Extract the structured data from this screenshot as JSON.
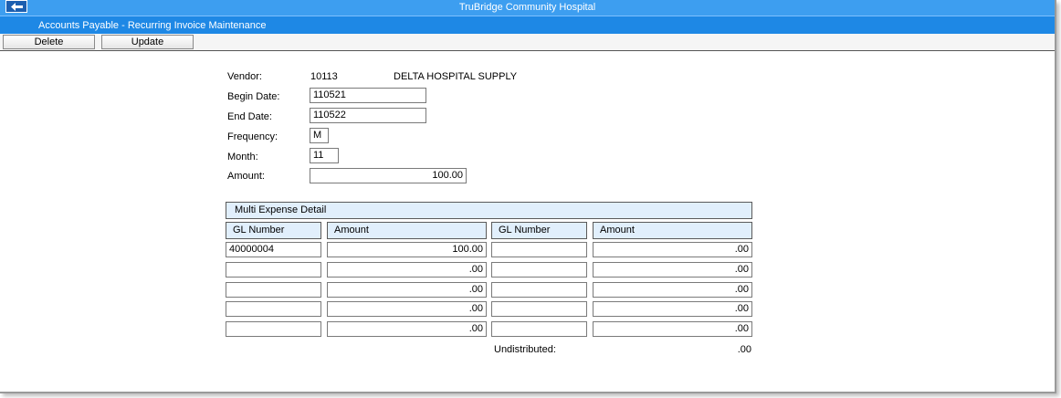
{
  "window": {
    "title": "TruBridge Community Hospital",
    "subtitle": "Accounts Payable - Recurring Invoice Maintenance"
  },
  "toolbar": {
    "delete_label": "Delete",
    "update_label": "Update"
  },
  "form": {
    "vendor_label": "Vendor:",
    "vendor_number": "10113",
    "vendor_name": "DELTA HOSPITAL SUPPLY",
    "begin_date_label": "Begin Date:",
    "begin_date": "110521",
    "end_date_label": "End Date:",
    "end_date": "110522",
    "frequency_label": "Frequency:",
    "frequency": "M",
    "month_label": "Month:",
    "month": "11",
    "amount_label": "Amount:",
    "amount": "100.00"
  },
  "detail": {
    "title": "Multi Expense Detail",
    "headers": [
      "GL Number",
      "Amount",
      "GL Number",
      "Amount"
    ],
    "rows": [
      [
        "40000004",
        "100.00",
        "",
        ".00"
      ],
      [
        "",
        ".00",
        "",
        ".00"
      ],
      [
        "",
        ".00",
        "",
        ".00"
      ],
      [
        "",
        ".00",
        "",
        ".00"
      ],
      [
        "",
        ".00",
        "",
        ".00"
      ]
    ],
    "undistributed_label": "Undistributed:",
    "undistributed_value": ".00"
  }
}
